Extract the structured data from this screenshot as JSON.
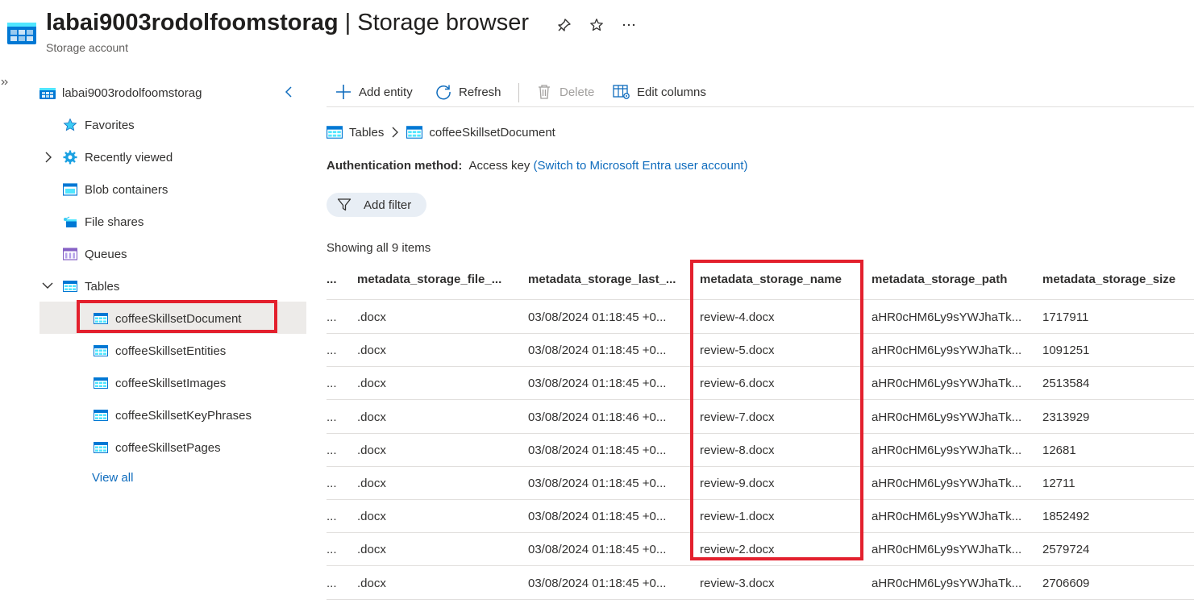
{
  "header": {
    "title_name": "labai9003rodolfoomstorag",
    "title_separator": " | ",
    "title_page": "Storage browser",
    "subtitle": "Storage account"
  },
  "sidebar": {
    "root": "labai9003rodolfoomstorag",
    "items": [
      {
        "label": "Favorites",
        "icon": "star-icon"
      },
      {
        "label": "Recently viewed",
        "icon": "gear-icon"
      },
      {
        "label": "Blob containers",
        "icon": "blob-container-icon"
      },
      {
        "label": "File shares",
        "icon": "file-share-icon"
      },
      {
        "label": "Queues",
        "icon": "queue-icon"
      },
      {
        "label": "Tables",
        "icon": "table-icon"
      }
    ],
    "tables": [
      {
        "label": "coffeeSkillsetDocument",
        "selected": true
      },
      {
        "label": "coffeeSkillsetEntities"
      },
      {
        "label": "coffeeSkillsetImages"
      },
      {
        "label": "coffeeSkillsetKeyPhrases"
      },
      {
        "label": "coffeeSkillsetPages"
      }
    ],
    "view_all": "View all"
  },
  "toolbar": {
    "add_entity": "Add entity",
    "refresh": "Refresh",
    "delete": "Delete",
    "edit_columns": "Edit columns"
  },
  "breadcrumb": {
    "root": "Tables",
    "current": "coffeeSkillsetDocument"
  },
  "auth": {
    "label": "Authentication method:",
    "value": "Access key",
    "switch_link": "(Switch to Microsoft Entra user account)"
  },
  "filter": {
    "add_filter": "Add filter"
  },
  "status": {
    "showing": "Showing all 9 items"
  },
  "table": {
    "columns": [
      "...",
      "metadata_storage_file_...",
      "metadata_storage_last_...",
      "metadata_storage_name",
      "metadata_storage_path",
      "metadata_storage_size"
    ],
    "rows": [
      [
        "...",
        ".docx",
        "03/08/2024 01:18:45 +0...",
        "review-4.docx",
        "aHR0cHM6Ly9sYWJhaTk...",
        "1717911"
      ],
      [
        "...",
        ".docx",
        "03/08/2024 01:18:45 +0...",
        "review-5.docx",
        "aHR0cHM6Ly9sYWJhaTk...",
        "1091251"
      ],
      [
        "...",
        ".docx",
        "03/08/2024 01:18:45 +0...",
        "review-6.docx",
        "aHR0cHM6Ly9sYWJhaTk...",
        "2513584"
      ],
      [
        "...",
        ".docx",
        "03/08/2024 01:18:46 +0...",
        "review-7.docx",
        "aHR0cHM6Ly9sYWJhaTk...",
        "2313929"
      ],
      [
        "...",
        ".docx",
        "03/08/2024 01:18:45 +0...",
        "review-8.docx",
        "aHR0cHM6Ly9sYWJhaTk...",
        "12681"
      ],
      [
        "...",
        ".docx",
        "03/08/2024 01:18:45 +0...",
        "review-9.docx",
        "aHR0cHM6Ly9sYWJhaTk...",
        "12711"
      ],
      [
        "...",
        ".docx",
        "03/08/2024 01:18:45 +0...",
        "review-1.docx",
        "aHR0cHM6Ly9sYWJhaTk...",
        "1852492"
      ],
      [
        "...",
        ".docx",
        "03/08/2024 01:18:45 +0...",
        "review-2.docx",
        "aHR0cHM6Ly9sYWJhaTk...",
        "2579724"
      ],
      [
        "...",
        ".docx",
        "03/08/2024 01:18:45 +0...",
        "review-3.docx",
        "aHR0cHM6Ly9sYWJhaTk...",
        "2706609"
      ]
    ]
  },
  "colors": {
    "accent": "#0f6cbd",
    "highlight_box": "#e3202d",
    "selected_bg": "#edebe9"
  }
}
